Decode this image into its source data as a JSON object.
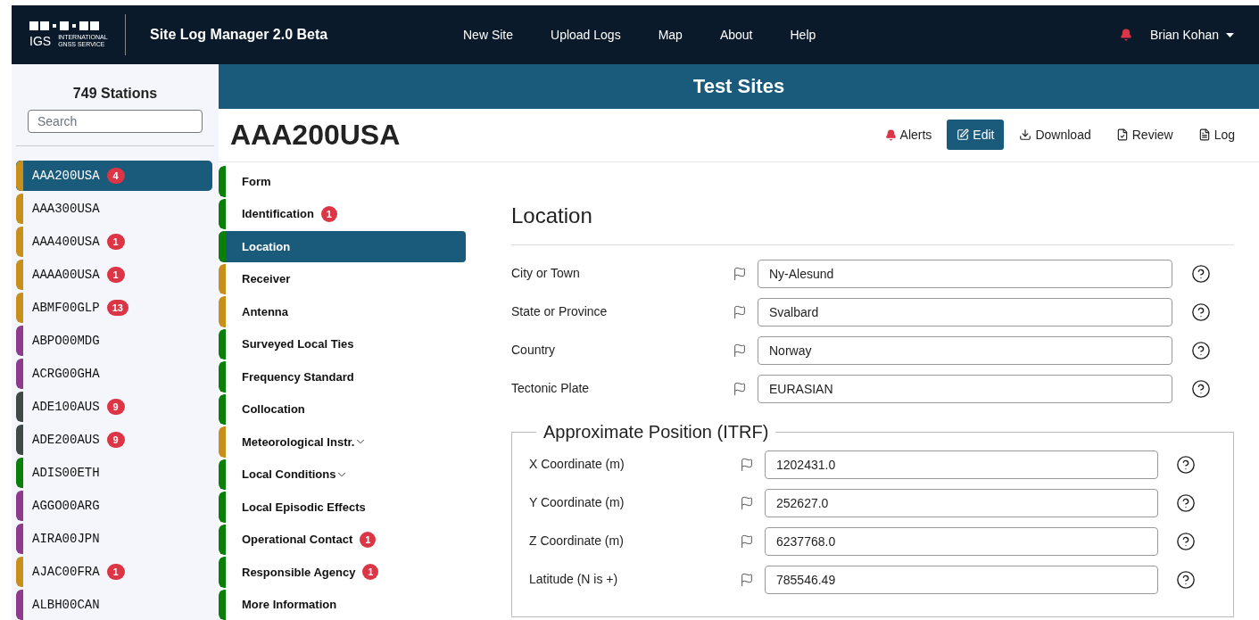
{
  "header": {
    "logo": {
      "acronym": "IGS",
      "line_1": "INTERNATIONAL",
      "line_2": "GNSS SERVICE"
    },
    "title": "Site Log Manager 2.0 Beta",
    "nav": [
      "New Site",
      "Upload Logs",
      "Map",
      "About",
      "Help"
    ],
    "user": "Brian Kohan"
  },
  "sidebar": {
    "count": "749 Stations",
    "search": {
      "placeholder": "Search"
    },
    "stations": [
      {
        "name": "AAA200USA",
        "badge": "4",
        "color": "#c8901a",
        "selected": true
      },
      {
        "name": "AAA300USA",
        "color": "#c8901a",
        "selected": false
      },
      {
        "name": "AAA400USA",
        "badge": "1",
        "color": "#c8901a",
        "selected": false
      },
      {
        "name": "AAAA00USA",
        "badge": "1",
        "color": "#c8901a",
        "selected": false
      },
      {
        "name": "ABMF00GLP",
        "badge": "13",
        "color": "#c8901a",
        "selected": false
      },
      {
        "name": "ABPO00MDG",
        "color": "#8e3b8e",
        "selected": false
      },
      {
        "name": "ACRG00GHA",
        "color": "#8e3b8e",
        "selected": false
      },
      {
        "name": "ADE100AUS",
        "badge": "9",
        "color": "#404848",
        "selected": false
      },
      {
        "name": "ADE200AUS",
        "badge": "9",
        "color": "#404848",
        "selected": false
      },
      {
        "name": "ADIS00ETH",
        "color": "#0a7f0a",
        "selected": false
      },
      {
        "name": "AGGO00ARG",
        "color": "#8e3b8e",
        "selected": false
      },
      {
        "name": "AIRA00JPN",
        "color": "#8e3b8e",
        "selected": false
      },
      {
        "name": "AJAC00FRA",
        "badge": "1",
        "color": "#c8901a",
        "selected": false
      },
      {
        "name": "ALBH00CAN",
        "color": "#8e3b8e",
        "selected": false
      }
    ]
  },
  "banner": "Test Sites",
  "site": {
    "name": "AAA200USA",
    "actions": [
      {
        "kind": "alerts",
        "label": "Alerts",
        "selected": false
      },
      {
        "kind": "edit",
        "label": "Edit",
        "selected": true
      },
      {
        "kind": "download",
        "label": "Download",
        "selected": false
      },
      {
        "kind": "review",
        "label": "Review",
        "selected": false
      },
      {
        "kind": "log",
        "label": "Log",
        "selected": false
      }
    ]
  },
  "sections": [
    {
      "label": "Form",
      "color": "#0a7f0a",
      "selected": false,
      "expandable": false
    },
    {
      "label": "Identification",
      "badge": "1",
      "color": "#0a7f0a",
      "selected": false,
      "expandable": false
    },
    {
      "label": "Location",
      "color": "#0a7f0a",
      "selected": true,
      "expandable": false
    },
    {
      "label": "Receiver",
      "color": "#c8901a",
      "selected": false,
      "expandable": false
    },
    {
      "label": "Antenna",
      "color": "#c8901a",
      "selected": false,
      "expandable": false
    },
    {
      "label": "Surveyed Local Ties",
      "color": "#0a7f0a",
      "selected": false,
      "expandable": false
    },
    {
      "label": "Frequency Standard",
      "color": "#0a7f0a",
      "selected": false,
      "expandable": false
    },
    {
      "label": "Collocation",
      "color": "#0a7f0a",
      "selected": false,
      "expandable": false
    },
    {
      "label": "Meteorological Instr.",
      "color": "#c8901a",
      "selected": false,
      "expandable": true
    },
    {
      "label": "Local Conditions",
      "color": "#0a7f0a",
      "selected": false,
      "expandable": true
    },
    {
      "label": "Local Episodic Effects",
      "color": "#0a7f0a",
      "selected": false,
      "expandable": false
    },
    {
      "label": "Operational Contact",
      "badge": "1",
      "color": "#0a7f0a",
      "selected": false,
      "expandable": false
    },
    {
      "label": "Responsible Agency",
      "badge": "1",
      "color": "#0a7f0a",
      "selected": false,
      "expandable": false
    },
    {
      "label": "More Information",
      "color": "#0a7f0a",
      "selected": false,
      "expandable": false
    }
  ],
  "form": {
    "title": "Location",
    "fields": [
      {
        "label": "City or Town",
        "value": "Ny-Alesund"
      },
      {
        "label": "State or Province",
        "value": "Svalbard"
      },
      {
        "label": "Country",
        "value": "Norway"
      },
      {
        "label": "Tectonic Plate",
        "value": "EURASIAN"
      }
    ],
    "group": {
      "legend": "Approximate Position (ITRF)",
      "fields": [
        {
          "label": "X Coordinate (m)",
          "value": "1202431.0"
        },
        {
          "label": "Y Coordinate (m)",
          "value": "252627.0"
        },
        {
          "label": "Z Coordinate (m)",
          "value": "6237768.0"
        },
        {
          "label": "Latitude (N is +)",
          "value": "785546.49"
        }
      ]
    }
  }
}
